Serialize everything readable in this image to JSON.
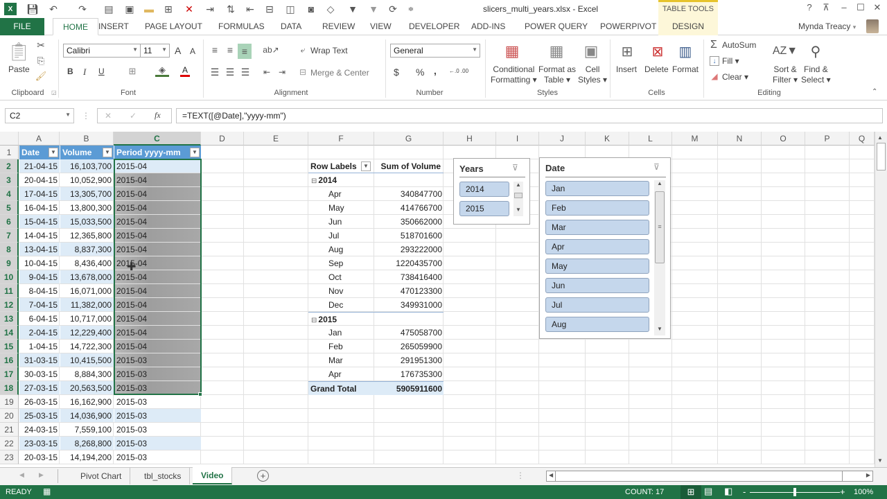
{
  "window": {
    "title": "slicers_multi_years.xlsx - Excel",
    "context_tab_group": "TABLE TOOLS",
    "help": "?",
    "controls": {
      "ribbon_display": "⊼",
      "minimize": "–",
      "maximize": "☐",
      "close": "✕"
    }
  },
  "quick_access": [
    "excel-logo-icon",
    "save-icon",
    "undo-icon",
    "redo-icon",
    "print-preview-icon",
    "print-icon",
    "open-folder-icon",
    "delete-rows-icon",
    "delete-cells-icon",
    "clear-icon",
    "sort-icon",
    "insert-icon",
    "insert-table-icon",
    "pivot-icon",
    "camera-icon",
    "shapes-icon",
    "filter-icon",
    "clear-filter-icon",
    "refresh-icon",
    "customize-icon"
  ],
  "tabs": [
    "FILE",
    "HOME",
    "INSERT",
    "PAGE LAYOUT",
    "FORMULAS",
    "DATA",
    "REVIEW",
    "VIEW",
    "DEVELOPER",
    "ADD-INS",
    "POWER QUERY",
    "POWERPIVOT",
    "DESIGN"
  ],
  "active_tab": "HOME",
  "user": {
    "name": "Mynda Treacy",
    "dropdown": "▾"
  },
  "ribbon": {
    "clipboard": {
      "label": "Clipboard",
      "paste": "Paste"
    },
    "font": {
      "label": "Font",
      "name": "Calibri",
      "size": "11",
      "bold": "B",
      "italic": "I",
      "underline": "U",
      "grow": "A",
      "shrink": "A",
      "font_color": "A"
    },
    "alignment": {
      "label": "Alignment",
      "wrap_text": "Wrap Text",
      "merge_center": "Merge & Center"
    },
    "number": {
      "label": "Number",
      "format": "General",
      "currency": "$",
      "percent": "%",
      "comma": ",",
      "inc_dec": "←.0 .00",
      "dec_dec": ".00 →.0"
    },
    "styles": {
      "label": "Styles",
      "conditional_formatting": [
        "Conditional",
        "Formatting ▾"
      ],
      "format_as_table": [
        "Format as",
        "Table ▾"
      ],
      "cell_styles": [
        "Cell",
        "Styles ▾"
      ]
    },
    "cells": {
      "label": "Cells",
      "insert": "Insert",
      "delete": "Delete",
      "format": "Format"
    },
    "editing": {
      "label": "Editing",
      "autosum": "AutoSum",
      "fill": "Fill ▾",
      "clear": "Clear ▾",
      "sort_filter": [
        "Sort &",
        "Filter ▾"
      ],
      "find_select": [
        "Find &",
        "Select ▾"
      ]
    }
  },
  "formula_bar": {
    "name_box": "C2",
    "cancel": "✕",
    "enter": "✓",
    "fx": "fx",
    "formula": "=TEXT([@Date],\"yyyy-mm\")"
  },
  "columns": [
    "A",
    "B",
    "C",
    "D",
    "E",
    "F",
    "G",
    "H",
    "I",
    "J",
    "K",
    "L",
    "M",
    "N",
    "O",
    "P",
    "Q"
  ],
  "selected_column": "C",
  "table": {
    "headers": [
      "Date",
      "Volume",
      "Period yyyy-mm"
    ],
    "rows": [
      [
        "21-04-15",
        "16,103,700",
        "2015-04"
      ],
      [
        "20-04-15",
        "10,052,900",
        "2015-04"
      ],
      [
        "17-04-15",
        "13,305,700",
        "2015-04"
      ],
      [
        "16-04-15",
        "13,800,300",
        "2015-04"
      ],
      [
        "15-04-15",
        "15,033,500",
        "2015-04"
      ],
      [
        "14-04-15",
        "12,365,800",
        "2015-04"
      ],
      [
        "13-04-15",
        "8,837,300",
        "2015-04"
      ],
      [
        "10-04-15",
        "8,436,400",
        "2015-04"
      ],
      [
        "9-04-15",
        "13,678,000",
        "2015-04"
      ],
      [
        "8-04-15",
        "16,071,000",
        "2015-04"
      ],
      [
        "7-04-15",
        "11,382,000",
        "2015-04"
      ],
      [
        "6-04-15",
        "10,717,000",
        "2015-04"
      ],
      [
        "2-04-15",
        "12,229,400",
        "2015-04"
      ],
      [
        "1-04-15",
        "14,722,300",
        "2015-04"
      ],
      [
        "31-03-15",
        "10,415,500",
        "2015-03"
      ],
      [
        "30-03-15",
        "8,884,300",
        "2015-03"
      ],
      [
        "27-03-15",
        "20,563,500",
        "2015-03"
      ],
      [
        "26-03-15",
        "16,162,900",
        "2015-03"
      ],
      [
        "25-03-15",
        "14,036,900",
        "2015-03"
      ],
      [
        "24-03-15",
        "7,559,100",
        "2015-03"
      ],
      [
        "23-03-15",
        "8,268,800",
        "2015-03"
      ],
      [
        "20-03-15",
        "14,194,200",
        "2015-03"
      ]
    ]
  },
  "pivot": {
    "row_labels": "Row Labels",
    "value_header": "Sum of Volume",
    "groups": [
      {
        "year": "2014",
        "items": [
          [
            "Apr",
            "340847700"
          ],
          [
            "May",
            "414766700"
          ],
          [
            "Jun",
            "350662000"
          ],
          [
            "Jul",
            "518701600"
          ],
          [
            "Aug",
            "293222000"
          ],
          [
            "Sep",
            "1220435700"
          ],
          [
            "Oct",
            "738416400"
          ],
          [
            "Nov",
            "470123300"
          ],
          [
            "Dec",
            "349931000"
          ]
        ]
      },
      {
        "year": "2015",
        "items": [
          [
            "Jan",
            "475058700"
          ],
          [
            "Feb",
            "265059900"
          ],
          [
            "Mar",
            "291951300"
          ],
          [
            "Apr",
            "176735300"
          ]
        ]
      }
    ],
    "grand_total_label": "Grand Total",
    "grand_total": "5905911600"
  },
  "slicers": {
    "years": {
      "title": "Years",
      "items": [
        "2014",
        "2015"
      ]
    },
    "date": {
      "title": "Date",
      "items": [
        "Jan",
        "Feb",
        "Mar",
        "Apr",
        "May",
        "Jun",
        "Jul",
        "Aug"
      ]
    }
  },
  "sheets": {
    "tabs": [
      "Pivot Chart",
      "tbl_stocks",
      "Video"
    ],
    "active": "Video",
    "add": "+"
  },
  "status": {
    "mode": "READY",
    "count": "COUNT: 17",
    "zoom": "100%",
    "zoom_level_percent": 100,
    "zoom_minus": "-",
    "zoom_plus": "+"
  }
}
